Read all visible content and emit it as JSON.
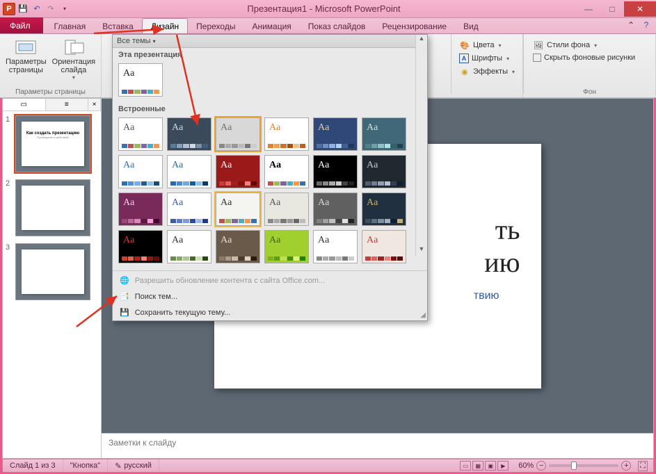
{
  "titlebar": {
    "title": "Презентация1 - Microsoft PowerPoint",
    "app_letter": "P"
  },
  "ribbon": {
    "file": "Файл",
    "tabs": [
      "Главная",
      "Вставка",
      "Дизайн",
      "Переходы",
      "Анимация",
      "Показ слайдов",
      "Рецензирование",
      "Вид"
    ],
    "active_tab": "Дизайн",
    "groups": {
      "page_setup": {
        "params": "Параметры\nстраницы",
        "orientation": "Ориентация\nслайда",
        "label": "Параметры страницы"
      },
      "themes_right": {
        "colors": "Цвета",
        "fonts": "Шрифты",
        "effects": "Эффекты"
      },
      "background": {
        "styles": "Стили фона",
        "hide": "Скрыть фоновые рисунки",
        "label": "Фон"
      }
    }
  },
  "gallery": {
    "header": "Все темы",
    "section_current": "Эта презентация",
    "section_builtin": "Встроенные",
    "menu_update": "Разрешить обновление контента с сайта Office.com...",
    "menu_browse": "Поиск тем...",
    "menu_save": "Сохранить текущую тему..."
  },
  "themes": {
    "current": [
      {
        "aa": "Aa",
        "bg": "#ffffff",
        "fg": "#222",
        "cols": [
          "#3a6fb0",
          "#c0504d",
          "#9bbb59",
          "#8064a2",
          "#4bacc6",
          "#f79646"
        ]
      }
    ],
    "builtin": [
      {
        "aa": "Aa",
        "bg": "#ffffff",
        "fg": "#555",
        "cols": [
          "#3a6fb0",
          "#c0504d",
          "#9bbb59",
          "#8064a2",
          "#4bacc6",
          "#f79646"
        ]
      },
      {
        "aa": "Aa",
        "bg": "#3a4a5a",
        "fg": "#d0d8e0",
        "cols": [
          "#5a7a9a",
          "#88a0b8",
          "#b0c0d0",
          "#d0d8e0",
          "#7a90a8",
          "#40607a"
        ]
      },
      {
        "aa": "Aa",
        "bg": "#d8d8d8",
        "fg": "#707070",
        "cols": [
          "#888",
          "#aaa",
          "#999",
          "#bbb",
          "#777",
          "#ccc"
        ],
        "sel": true
      },
      {
        "aa": "Aa",
        "bg": "#ffffff",
        "fg": "#e08030",
        "cols": [
          "#e08030",
          "#f0a050",
          "#d07020",
          "#a05010",
          "#f0c080",
          "#c06020"
        ]
      },
      {
        "aa": "Aa",
        "bg": "#304878",
        "fg": "#e0d0b0",
        "cols": [
          "#5070a0",
          "#7090c0",
          "#90b0e0",
          "#b0d0f0",
          "#406090",
          "#203858"
        ]
      },
      {
        "aa": "Aa",
        "bg": "#406878",
        "fg": "#d0e0e0",
        "cols": [
          "#50808a",
          "#70a0aa",
          "#90c0ca",
          "#b0e0ea",
          "#30606a",
          "#204050"
        ]
      },
      {
        "aa": "Aa",
        "bg": "#ffffff",
        "fg": "#3070b0",
        "cols": [
          "#3070b0",
          "#5090d0",
          "#70b0f0",
          "#2a5a8a",
          "#88c0f0",
          "#1a4a7a"
        ]
      },
      {
        "aa": "Aa",
        "bg": "#ffffff",
        "fg": "#2a6aaa",
        "cols": [
          "#2a6aaa",
          "#4a8aca",
          "#6aaAEA",
          "#1a5a9a",
          "#8ac0f0",
          "#0a3a6a"
        ]
      },
      {
        "aa": "Aa",
        "bg": "#9a1a1a",
        "fg": "#ffffff",
        "cols": [
          "#c04040",
          "#e06060",
          "#a02020",
          "#801010",
          "#f08080",
          "#600808"
        ]
      },
      {
        "aa": "Aa",
        "bg": "#ffffff",
        "fg": "#000000",
        "bold": true,
        "cols": [
          "#c0504d",
          "#9bbb59",
          "#8064a2",
          "#4bacc6",
          "#f79646",
          "#3a6fb0"
        ]
      },
      {
        "aa": "Aa",
        "bg": "#000000",
        "fg": "#ffffff",
        "cols": [
          "#666",
          "#888",
          "#aaa",
          "#ccc",
          "#444",
          "#222"
        ]
      },
      {
        "aa": "Aa",
        "bg": "#202830",
        "fg": "#c0c8d0",
        "cols": [
          "#506070",
          "#708090",
          "#90a0b0",
          "#b0c0d0",
          "#304050",
          "#102030"
        ]
      },
      {
        "aa": "Aa",
        "bg": "#7a2a5a",
        "fg": "#f0d0e0",
        "cols": [
          "#9a4a7a",
          "#ba6a9a",
          "#da8aba",
          "#5a1a3a",
          "#fa9ada",
          "#3a0a2a"
        ]
      },
      {
        "aa": "Aa",
        "bg": "#ffffff",
        "fg": "#3a5aaa",
        "cols": [
          "#3a5aaa",
          "#5a7aca",
          "#7a9aea",
          "#2a4a9a",
          "#9abaf0",
          "#1a3a8a"
        ]
      },
      {
        "aa": "Aa",
        "bg": "#f4f4f0",
        "fg": "#333",
        "cols": [
          "#c0504d",
          "#9bbb59",
          "#8064a2",
          "#4bacc6",
          "#f79646",
          "#3a6fb0"
        ],
        "hover": true
      },
      {
        "aa": "Aa",
        "bg": "#e8e8e0",
        "fg": "#555",
        "border": "fancy",
        "cols": [
          "#888",
          "#aaa",
          "#777",
          "#999",
          "#666",
          "#bbb"
        ]
      },
      {
        "aa": "Aa",
        "bg": "#606060",
        "fg": "#d8d8d8",
        "cols": [
          "#808080",
          "#a0a0a0",
          "#c0c0c0",
          "#404040",
          "#e0e0e0",
          "#202020"
        ]
      },
      {
        "aa": "Aa",
        "bg": "#203040",
        "fg": "#d0b060",
        "cols": [
          "#405060",
          "#607080",
          "#8090a0",
          "#a0b0c0",
          "#102030",
          "#c0b070"
        ]
      },
      {
        "aa": "Aa",
        "bg": "#000000",
        "fg": "#d04030",
        "cols": [
          "#d04030",
          "#e06050",
          "#b02010",
          "#f08070",
          "#901808",
          "#700800"
        ]
      },
      {
        "aa": "Aa",
        "bg": "#ffffff",
        "fg": "#333",
        "cols": [
          "#6a8a4a",
          "#8aaa6a",
          "#aaca8a",
          "#4a6a2a",
          "#cae0aa",
          "#2a4a0a"
        ]
      },
      {
        "aa": "Aa",
        "bg": "#6a5a4a",
        "fg": "#e8e0d0",
        "cols": [
          "#8a7a6a",
          "#aa9a8a",
          "#cabaaa",
          "#4a3a2a",
          "#e0d0c0",
          "#2a1a0a"
        ]
      },
      {
        "aa": "Aa",
        "bg": "#a0d030",
        "fg": "#406010",
        "cols": [
          "#80b020",
          "#60a010",
          "#c0e050",
          "#409008",
          "#e0f080",
          "#208000"
        ]
      },
      {
        "aa": "Aa",
        "bg": "#ffffff",
        "fg": "#333",
        "cols": [
          "#888",
          "#aaa",
          "#999",
          "#bbb",
          "#777",
          "#ccc"
        ]
      },
      {
        "aa": "Aa",
        "bg": "#f0e8e0",
        "fg": "#c04040",
        "cols": [
          "#c04040",
          "#e06060",
          "#a02020",
          "#f08080",
          "#801010",
          "#600808"
        ]
      }
    ]
  },
  "panel": {
    "tab_slides_icon": "▭",
    "tab_outline_icon": "≡",
    "close_icon": "×"
  },
  "slide_thumbs": [
    {
      "title": "Как создать презентацию",
      "sub": "Руководство к действию"
    },
    {
      "title": "",
      "sub": ""
    },
    {
      "title": "",
      "sub": ""
    }
  ],
  "main_slide": {
    "title_tail": "ть\nию",
    "subtitle_tail": "твию"
  },
  "notes_placeholder": "Заметки к слайду",
  "status": {
    "slide_of": "Слайд 1 из 3",
    "theme": "\"Кнопка\"",
    "language": "русский",
    "zoom": "60%"
  }
}
